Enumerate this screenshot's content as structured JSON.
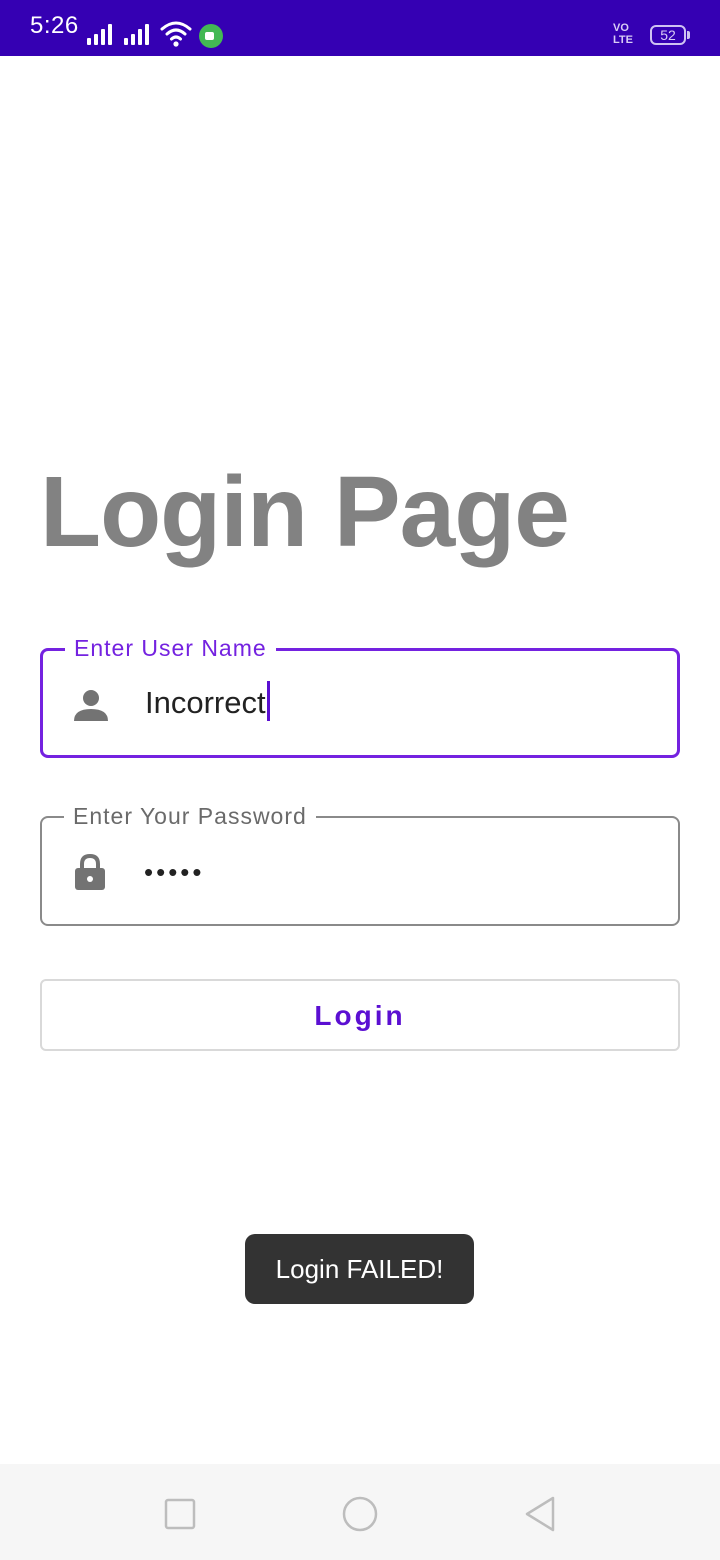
{
  "status_bar": {
    "time": "5:26",
    "volte": "VO LTE",
    "battery": "52",
    "background": "#3500b3"
  },
  "page": {
    "title": "Login Page"
  },
  "username_field": {
    "label": "Enter User Name",
    "value": "Incorrect",
    "icon": "person-icon",
    "focused": true,
    "accent": "#7422e0"
  },
  "password_field": {
    "label": "Enter Your Password",
    "value": "•••••",
    "icon": "lock-icon",
    "focused": false
  },
  "login_button": {
    "label": "Login",
    "color": "#5b0fd2"
  },
  "toast": {
    "message": "Login FAILED!"
  },
  "nav_bar": {
    "buttons": [
      "recents-icon",
      "home-icon",
      "back-icon"
    ]
  }
}
